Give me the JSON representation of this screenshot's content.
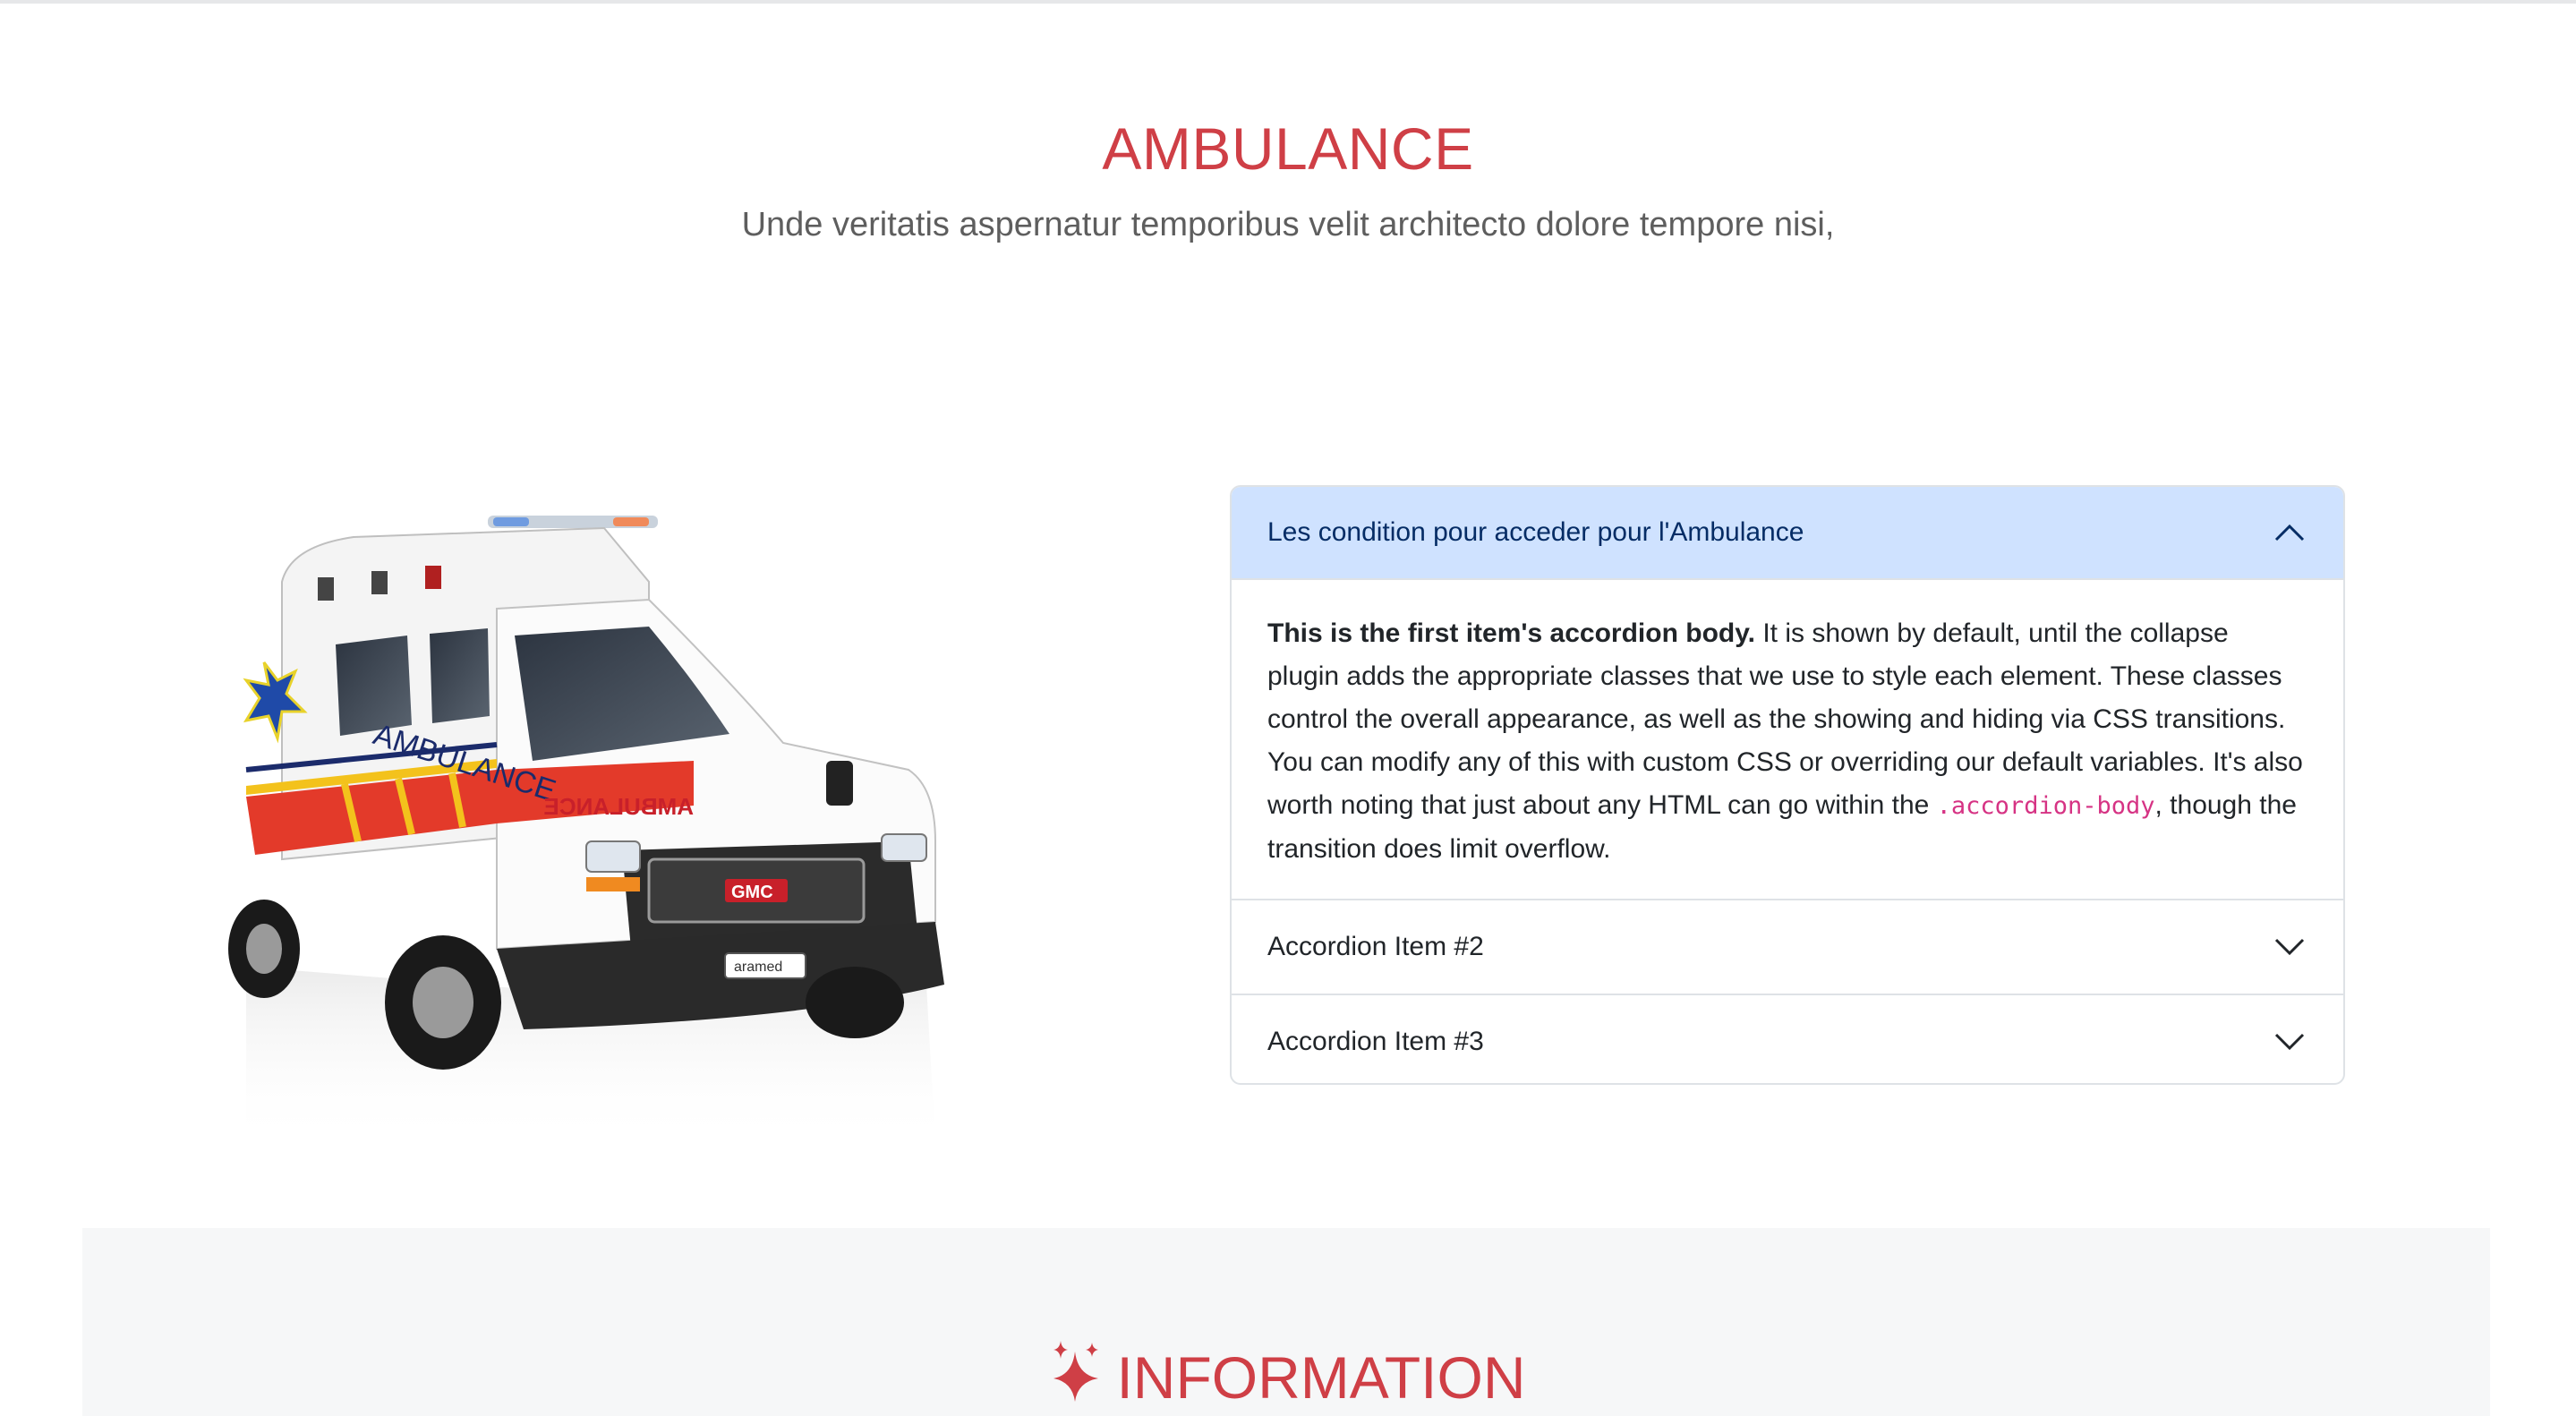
{
  "hero": {
    "title": "AMBULANCE",
    "subtitle": "Unde veritatis aspernatur temporibus velit architecto dolore tempore nisi,"
  },
  "vehicle": {
    "roof_text": "AMBULANCE",
    "side_text": "AMBULANCE",
    "grille_badge": "GMC",
    "plate": "aramed"
  },
  "accordion": {
    "items": [
      {
        "title": "Les condition pour acceder pour l'Ambulance",
        "expanded": true,
        "icon": "chevron-up-icon",
        "body": {
          "lead": "This is the first item's accordion body.",
          "text": " It is shown by default, until the collapse plugin adds the appropriate classes that we use to style each element. These classes control the overall appearance, as well as the showing and hiding via CSS transitions. You can modify any of this with custom CSS or overriding our default variables. It's also worth noting that just about any HTML can go within the ",
          "code": ".accordion-body",
          "tail": ", though the transition does limit overflow."
        }
      },
      {
        "title": "Accordion Item #2",
        "expanded": false,
        "icon": "chevron-down-icon"
      },
      {
        "title": "Accordion Item #3",
        "expanded": false,
        "icon": "chevron-down-icon"
      }
    ]
  },
  "information": {
    "title": "INFORMATION",
    "icon": "sparkles-icon"
  },
  "colors": {
    "accent_red": "#cf3f46",
    "accordion_active_bg": "#cfe2ff",
    "accordion_active_text": "#052c65",
    "code_pink": "#d63384"
  }
}
